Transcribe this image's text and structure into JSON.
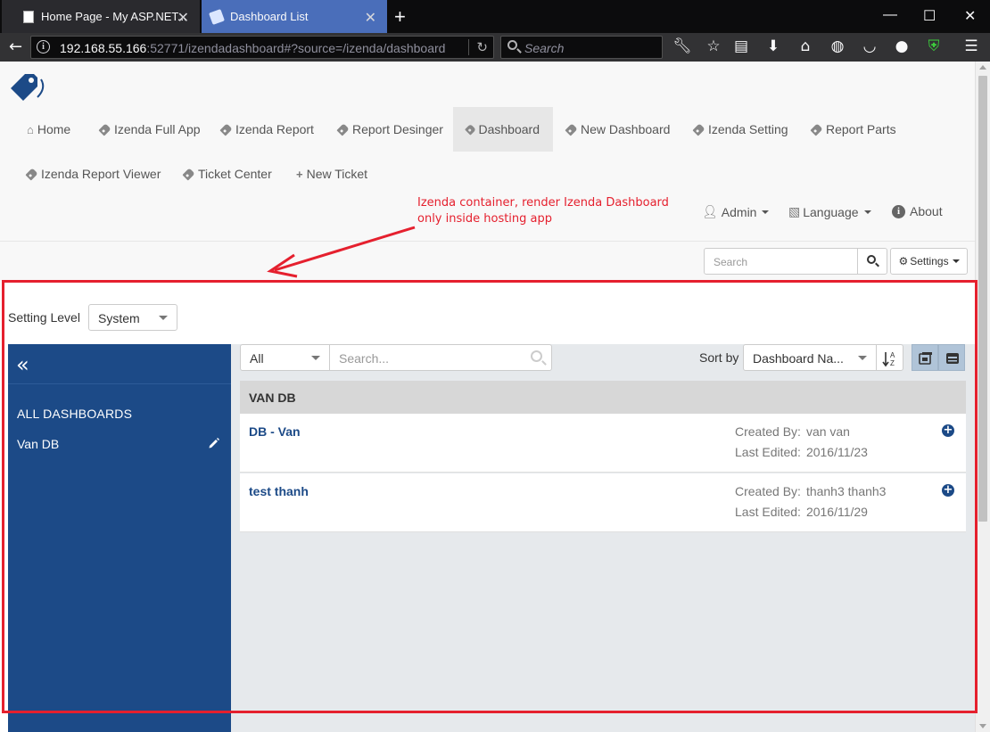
{
  "browser": {
    "tabs": [
      {
        "label": "Home Page - My ASP.NET..."
      },
      {
        "label": "Dashboard List"
      }
    ],
    "url_host": "192.168.55.166",
    "url_rest": ":52771/izendadashboard#?source=/izenda/dashboard",
    "search_placeholder": "Search"
  },
  "nav": {
    "menu": [
      {
        "label": "Home",
        "icon": "home-icon"
      },
      {
        "label": "Izenda Full App",
        "icon": "tag-icon"
      },
      {
        "label": "Izenda Report",
        "icon": "tag-icon"
      },
      {
        "label": "Report Desinger",
        "icon": "tag-icon"
      },
      {
        "label": "Dashboard",
        "icon": "tag-icon",
        "active": true
      },
      {
        "label": "New Dashboard",
        "icon": "tag-icon"
      },
      {
        "label": "Izenda Setting",
        "icon": "tag-icon"
      },
      {
        "label": "Report Parts",
        "icon": "tag-icon"
      },
      {
        "label": "Izenda Report Viewer",
        "icon": "tag-icon"
      },
      {
        "label": "Ticket Center",
        "icon": "tag-icon"
      },
      {
        "label": "New Ticket",
        "icon": "plus-icon"
      }
    ],
    "user": "Admin",
    "language": "Language",
    "about": "About"
  },
  "annotation": {
    "text": "Izenda container, render Izenda Dashboard only inside hosting app",
    "color": "#e5202e"
  },
  "toolbar": {
    "search_placeholder": "Search",
    "settings_label": "Settings"
  },
  "izenda": {
    "setting_level_label": "Setting Level",
    "setting_level_value": "System",
    "sidebar": {
      "all_label": "ALL DASHBOARDS",
      "items": [
        {
          "label": "Van DB"
        }
      ]
    },
    "filter_value": "All",
    "search_placeholder": "Search...",
    "sort_label": "Sort by",
    "sort_value": "Dashboard Na...",
    "group_name": "VAN DB",
    "cards": [
      {
        "title": "DB - Van",
        "created_label": "Created By:",
        "created_by": "van van",
        "edited_label": "Last Edited:",
        "edited": "2016/11/23"
      },
      {
        "title": "test thanh",
        "created_label": "Created By:",
        "created_by": "thanh3 thanh3",
        "edited_label": "Last Edited:",
        "edited": "2016/11/29"
      }
    ],
    "colors": {
      "sidebar": "#1c4a87",
      "panel": "#e6e9ec",
      "title": "#1c4a87"
    }
  }
}
